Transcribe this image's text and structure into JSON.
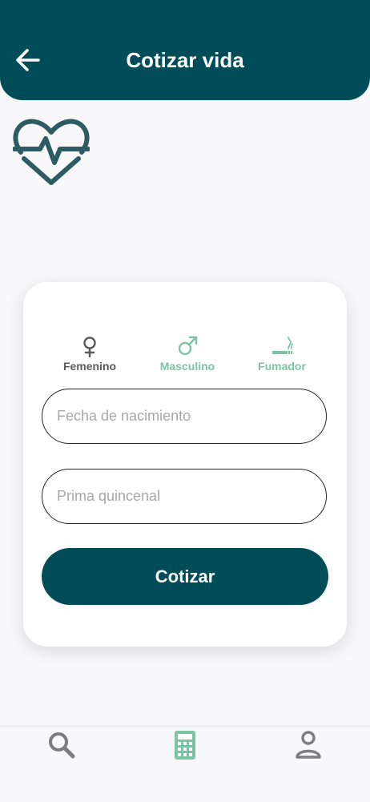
{
  "header": {
    "title": "Cotizar vida",
    "back_icon": "arrow-left-icon",
    "background": "#004c59"
  },
  "logo": {
    "icon": "heart-pulse-icon",
    "color": "#2e5a62"
  },
  "form": {
    "options": [
      {
        "label": "Femenino",
        "icon": "female-symbol-icon",
        "color": "#5b5b5b"
      },
      {
        "label": "Masculino",
        "icon": "male-symbol-icon",
        "color": "#7cc3a5"
      },
      {
        "label": "Fumador",
        "icon": "smoking-icon",
        "color": "#7cc3a5"
      }
    ],
    "birthdate": {
      "placeholder": "Fecha de nacimiento",
      "value": ""
    },
    "premium": {
      "placeholder": "Prima quincenal",
      "value": ""
    },
    "submit_label": "Cotizar"
  },
  "bottom_nav": {
    "items": [
      {
        "icon": "search-icon",
        "color": "#7d7d7d",
        "active": false
      },
      {
        "icon": "calculator-icon",
        "color": "#7cc3a5",
        "active": true
      },
      {
        "icon": "user-icon",
        "color": "#7d7d7d",
        "active": false
      }
    ]
  }
}
